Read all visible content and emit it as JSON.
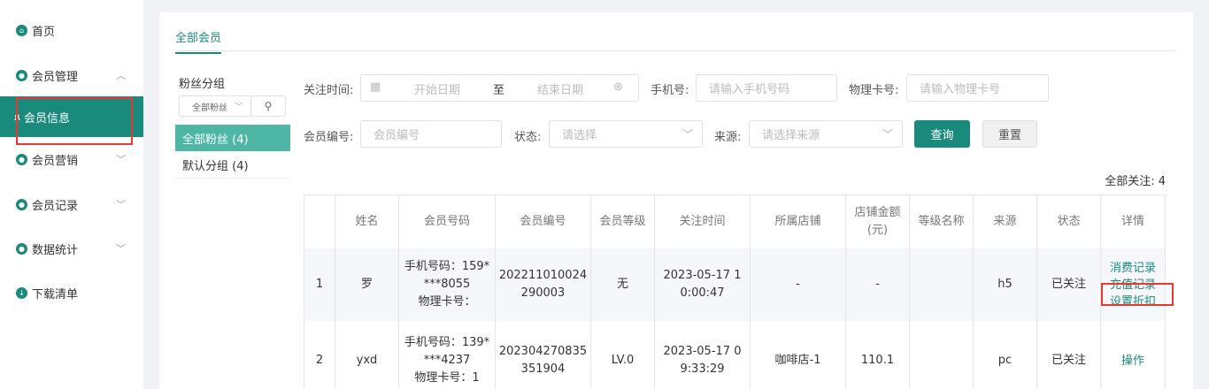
{
  "sidebar": {
    "items": [
      {
        "label": "首页"
      },
      {
        "label": "会员管理"
      },
      {
        "label": "会员信息"
      },
      {
        "label": "会员营销"
      },
      {
        "label": "会员记录"
      },
      {
        "label": "数据统计"
      },
      {
        "label": "下载清单"
      }
    ]
  },
  "tabs": {
    "active": "全部会员"
  },
  "groups": {
    "title": "粉丝分组",
    "select_value": "全部粉丝",
    "items": [
      {
        "label": "全部粉丝 (4)"
      },
      {
        "label": "默认分组 (4)"
      }
    ]
  },
  "filters": {
    "follow_time_label": "关注时间:",
    "start_placeholder": "开始日期",
    "range_sep": "至",
    "end_placeholder": "结束日期",
    "phone_label": "手机号:",
    "phone_placeholder": "请输入手机号码",
    "card_label": "物理卡号:",
    "card_placeholder": "请输入物理卡号",
    "member_no_label": "会员编号:",
    "member_no_placeholder": "会员编号",
    "status_label": "状态:",
    "status_placeholder": "请选择",
    "source_label": "来源:",
    "source_placeholder": "请选择来源",
    "query_button": "查询",
    "reset_button": "重置"
  },
  "total_label": "全部关注: 4",
  "table": {
    "columns": [
      "姓名",
      "会员号码",
      "会员编号",
      "会员等级",
      "关注时间",
      "所属店铺",
      "店铺金额",
      "(元)",
      "等级名称",
      "来源",
      "状态",
      "详情"
    ],
    "rows": [
      {
        "index": "1",
        "name": "罗",
        "phone_line1": "手机号码：159*",
        "phone_line2": "***8055",
        "phone_line3": "物理卡号：",
        "member_no_1": "202211010024",
        "member_no_2": "290003",
        "level": "无",
        "time_1": "2023-05-17 1",
        "time_2": "0:00:47",
        "store": "-",
        "amount": "-",
        "level_name": "",
        "source": "h5",
        "status": "已关注",
        "actions": [
          "消费记录",
          "充值记录",
          "设置折扣"
        ]
      },
      {
        "index": "2",
        "name": "yxd",
        "phone_line1": "手机号码：139*",
        "phone_line2": "***4237",
        "phone_line3": "物理卡号：1",
        "member_no_1": "202304270835",
        "member_no_2": "351904",
        "level": "LV.0",
        "time_1": "2023-05-17 0",
        "time_2": "9:33:29",
        "store": "咖啡店-1",
        "amount": "110.1",
        "level_name": "",
        "source": "pc",
        "status": "已关注",
        "actions": [
          "操作"
        ]
      }
    ]
  },
  "colors": {
    "accent": "#1a8a7c",
    "highlight_box": "#e53935"
  }
}
